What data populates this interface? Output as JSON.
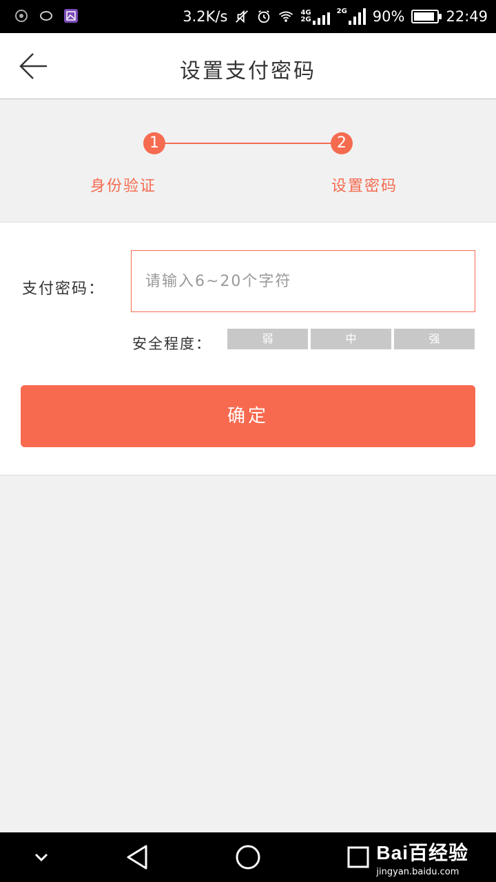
{
  "status_bar": {
    "net_speed": "3.2K/s",
    "net_top": "4G",
    "net_bottom": "2G",
    "net_2g": "2G",
    "battery_percent": "90%",
    "battery_level": 0.9,
    "time": "22:49"
  },
  "app_bar": {
    "title": "设置支付密码",
    "back_icon": "arrow-left-icon"
  },
  "steps": [
    {
      "number": "1",
      "label": "身份验证"
    },
    {
      "number": "2",
      "label": "设置密码"
    }
  ],
  "form": {
    "password_label": "支付密码：",
    "password_placeholder": "请输入6~20个字符",
    "password_value": "",
    "strength_label": "安全程度：",
    "strength_levels": [
      "弱",
      "中",
      "强"
    ],
    "confirm_label": "确定"
  },
  "watermark": {
    "brand": "Bai百经验",
    "url": "jingyan.baidu.com"
  },
  "colors": {
    "accent": "#f56b50",
    "button": "#f76a50",
    "strength_inactive": "#c8c8c8"
  }
}
